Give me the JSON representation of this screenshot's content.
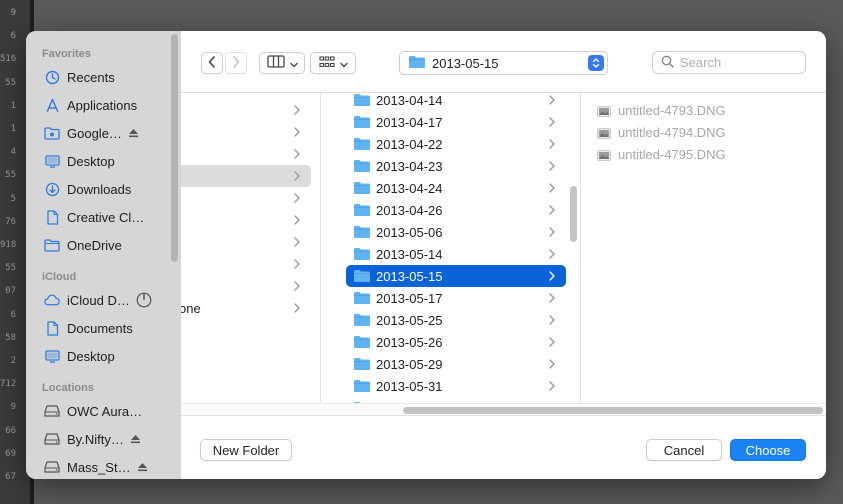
{
  "background": {
    "line_numbers": [
      "9",
      "6",
      "516",
      "55",
      "1",
      "1",
      "4",
      "55",
      "5",
      "76",
      "918",
      "55",
      "07",
      "6",
      "58",
      "2",
      "712",
      "9",
      "66",
      "69",
      "67"
    ]
  },
  "sidebar": {
    "sections": [
      {
        "title": "Favorites",
        "items": [
          {
            "label": "Recents",
            "icon": "clock-icon"
          },
          {
            "label": "Applications",
            "icon": "applications-icon"
          },
          {
            "label": "Google…",
            "icon": "drive-folder-icon",
            "extra": "eject-icon"
          },
          {
            "label": "Desktop",
            "icon": "desktop-icon"
          },
          {
            "label": "Downloads",
            "icon": "downloads-icon"
          },
          {
            "label": "Creative Cl…",
            "icon": "document-icon"
          },
          {
            "label": "OneDrive",
            "icon": "folder-icon"
          }
        ]
      },
      {
        "title": "iCloud",
        "items": [
          {
            "label": "iCloud D…",
            "icon": "cloud-icon",
            "extra": "progress-icon"
          },
          {
            "label": "Documents",
            "icon": "document-icon"
          },
          {
            "label": "Desktop",
            "icon": "desktop-icon"
          }
        ]
      },
      {
        "title": "Locations",
        "items": [
          {
            "label": "OWC Aura…",
            "icon": "drive-icon"
          },
          {
            "label": "By.Nifty…",
            "icon": "drive-icon",
            "extra": "eject-icon"
          },
          {
            "label": "Mass_St…",
            "icon": "drive-icon",
            "extra": "eject-icon"
          }
        ]
      }
    ]
  },
  "toolbar": {
    "path_label": "2013-05-15",
    "search_placeholder": "Search"
  },
  "column1": {
    "rows": [
      {
        "label": "",
        "selected": false
      },
      {
        "label": "",
        "selected": false
      },
      {
        "label": "",
        "selected": false
      },
      {
        "label": "",
        "selected": true
      },
      {
        "label": "",
        "selected": false
      },
      {
        "label": "",
        "selected": false
      },
      {
        "label": "",
        "selected": false
      },
      {
        "label": "",
        "selected": false
      },
      {
        "label": "",
        "selected": false
      },
      {
        "label": "one",
        "selected": false
      }
    ]
  },
  "column2": {
    "rows": [
      {
        "label": "2013-04-14",
        "selected": false
      },
      {
        "label": "2013-04-17",
        "selected": false
      },
      {
        "label": "2013-04-22",
        "selected": false
      },
      {
        "label": "2013-04-23",
        "selected": false
      },
      {
        "label": "2013-04-24",
        "selected": false
      },
      {
        "label": "2013-04-26",
        "selected": false
      },
      {
        "label": "2013-05-06",
        "selected": false
      },
      {
        "label": "2013-05-14",
        "selected": false
      },
      {
        "label": "2013-05-15",
        "selected": true
      },
      {
        "label": "2013-05-17",
        "selected": false
      },
      {
        "label": "2013-05-25",
        "selected": false
      },
      {
        "label": "2013-05-26",
        "selected": false
      },
      {
        "label": "2013-05-29",
        "selected": false
      },
      {
        "label": "2013-05-31",
        "selected": false
      }
    ]
  },
  "column3": {
    "files": [
      {
        "label": "untitled-4793.DNG",
        "icon": "image-file-icon"
      },
      {
        "label": "untitled-4794.DNG",
        "icon": "image-file-icon"
      },
      {
        "label": "untitled-4795.DNG",
        "icon": "image-file-icon"
      }
    ]
  },
  "footer": {
    "new_folder_label": "New Folder",
    "cancel_label": "Cancel",
    "choose_label": "Choose"
  },
  "colors": {
    "accent": "#1b84f2",
    "selection": "#0a64d8",
    "folder": "#5fb3f0"
  }
}
